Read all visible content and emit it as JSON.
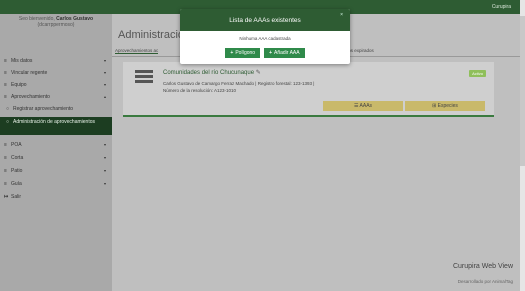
{
  "topbar": {
    "brand": "Curupira"
  },
  "sidebar": {
    "welcome_prefix": "Seo bienvenido,",
    "welcome_name": "Carlos Gustavo",
    "welcome_user": "(dcarrppermoso)",
    "items": [
      {
        "label": "Mis datos",
        "icon": "list-icon",
        "chevron": "▾"
      },
      {
        "label": "Vincular regente",
        "icon": "list-icon",
        "chevron": "▾"
      },
      {
        "label": "Equipo",
        "icon": "list-icon",
        "chevron": "▾"
      },
      {
        "label": "Aprovechamiento",
        "icon": "list-icon",
        "chevron": "▴"
      },
      {
        "label": "Registrar aprovechamiento",
        "icon": "circle-icon"
      },
      {
        "label": "Administración de aprovechamientos",
        "icon": "circle-icon"
      },
      {
        "label": "POA",
        "icon": "list-icon",
        "chevron": "▾"
      },
      {
        "label": "Corta",
        "icon": "list-icon",
        "chevron": "▾"
      },
      {
        "label": "Patio",
        "icon": "list-icon",
        "chevron": "▾"
      },
      {
        "label": "Guía",
        "icon": "list-icon",
        "chevron": "▾"
      },
      {
        "label": "Salir",
        "icon": "exit-icon"
      }
    ]
  },
  "main": {
    "title": "Administració",
    "tabs": [
      "Aprovechamientos ac",
      "entos expirados"
    ]
  },
  "card": {
    "title": "Comunidades del río Chucunaque",
    "edit_icon": "✎",
    "line1": "Carlos Gustavo de Camargo Ferraz Machado  |  Registro forestal: 123-1393  |",
    "line2": "Número de la resolución:  A123-1010",
    "status": "Activo",
    "btn_aaas": "☰  AAAs",
    "btn_especies": "⊞  Especies"
  },
  "modal": {
    "title": "Lista de AAAs existentes",
    "close": "×",
    "message": "Ninhuma AAA cadastrada",
    "btn_poligono": "Polígono",
    "btn_anadir": "Añadir AAA",
    "btn_symbol": "+"
  },
  "footer": {
    "title": "Curupira Web View",
    "credit": "Desarrollado por AnimalTag"
  },
  "colors": {
    "topbar": "#2e5c33",
    "active_nav": "#1c3d21",
    "button_green": "#2f8a4a",
    "card_button": "#c9b96a",
    "status": "#8fbf5a"
  }
}
